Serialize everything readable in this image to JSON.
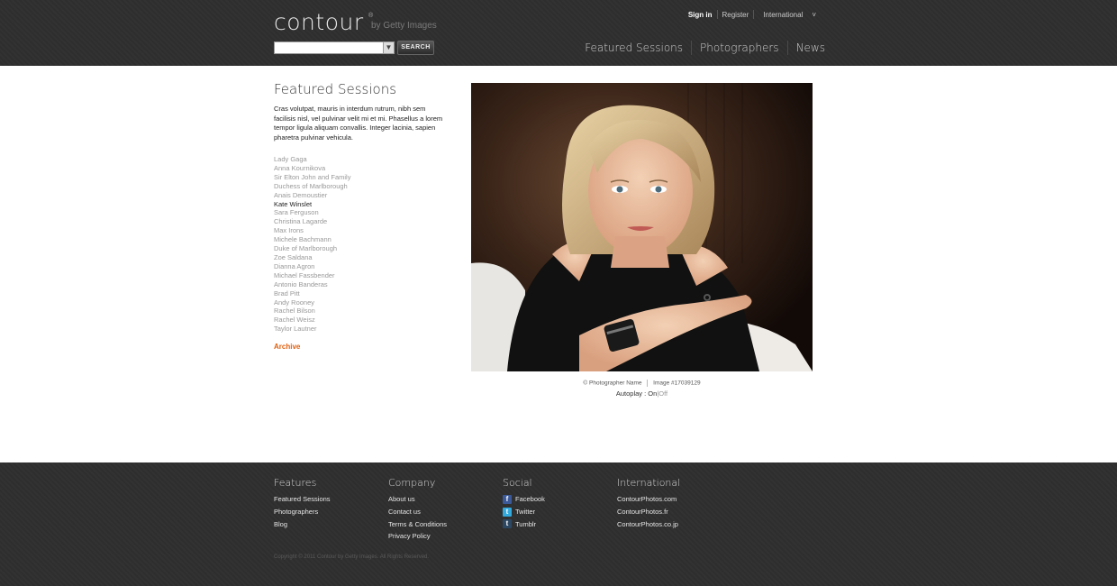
{
  "header": {
    "logo": "contour",
    "logo_by": "by Getty Images",
    "search_button": "SEARCH",
    "search_placeholder": "",
    "toplinks": {
      "signin": "Sign in",
      "register": "Register",
      "international": "International"
    },
    "nav": [
      "Featured Sessions",
      "Photographers",
      "News"
    ]
  },
  "main": {
    "title": "Featured Sessions",
    "intro": "Cras volutpat, mauris in interdum rutrum, nibh sem facilisis nisl, vel pulvinar velit mi et mi. Phasellus a lorem tempor ligula aliquam convallis. Integer lacinia, sapien pharetra pulvinar vehicula.",
    "names": [
      "Lady Gaga",
      "Anna Kournikova",
      "Sir Elton John and Family",
      "Duchess of Marlborough",
      "Anais Demoustier",
      "Kate Winslet",
      "Sara Ferguson",
      "Christina Lagarde",
      "Max Irons",
      "Michele Bachmann",
      "Duke of Marlborough",
      "Zoe Saldana",
      "Dianna Agron",
      "Michael Fassbender",
      "Antonio Banderas",
      "Brad Pitt",
      "Andy Rooney",
      "Rachel Bilson",
      "Rachel Weisz",
      "Taylor Lautner"
    ],
    "active_name": "Kate Winslet",
    "archive": "Archive",
    "credit_photographer": "© Photographer Name",
    "credit_image": "Image #17039129",
    "autoplay_label": "Autoplay :",
    "autoplay_on": "On",
    "autoplay_sep": "|",
    "autoplay_off": "Off"
  },
  "footer": {
    "features": {
      "title": "Features",
      "links": [
        "Featured Sessions",
        "Photographers",
        "Blog"
      ]
    },
    "company": {
      "title": "Company",
      "links": [
        "About us",
        "Contact us",
        "Terms & Conditions",
        "Privacy Policy"
      ]
    },
    "social": {
      "title": "Social",
      "links": [
        "Facebook",
        "Twitter",
        "Tumblr"
      ]
    },
    "international": {
      "title": "International",
      "links": [
        "ContourPhotos.com",
        "ContourPhotos.fr",
        "ContourPhotos.co.jp"
      ]
    },
    "copyright": "Copyright © 2011 Contour by Getty Images. All Rights Reserved."
  },
  "colors": {
    "header_bg": "#2f2f2f",
    "accent": "#e0600e",
    "facebook": "#3b5998",
    "twitter": "#33aadd",
    "tumblr": "#2c4762"
  }
}
